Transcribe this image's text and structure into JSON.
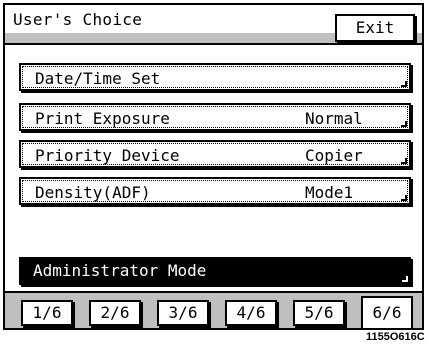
{
  "header": {
    "title": "User's Choice",
    "exit_label": "Exit"
  },
  "rows": [
    {
      "label": "Date/Time Set",
      "value": ""
    },
    {
      "label": "Print Exposure",
      "value": "Normal"
    },
    {
      "label": "Priority Device",
      "value": "Copier"
    },
    {
      "label": "Density(ADF)",
      "value": "Mode1"
    }
  ],
  "admin": {
    "label": "Administrator Mode"
  },
  "tabs": [
    "1/6",
    "2/6",
    "3/6",
    "4/6",
    "5/6",
    "6/6"
  ],
  "active_tab": "6/6",
  "figure_code": "1155O616C"
}
